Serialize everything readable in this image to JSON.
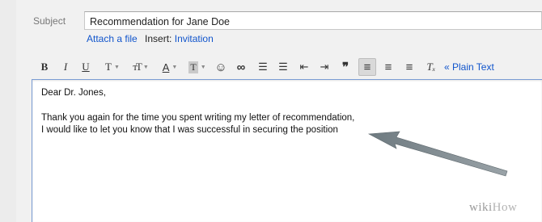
{
  "compose": {
    "subject_label": "Subject",
    "subject_value": "Recommendation for Jane Doe",
    "attach_label": "Attach a file",
    "insert_label": "Insert:",
    "invitation_label": "Invitation"
  },
  "toolbar": {
    "bold": "B",
    "italic": "I",
    "underline": "U",
    "font": "T",
    "size": "ᴛ",
    "text_color": "A",
    "highlight": "T",
    "emoji": "☺",
    "link": "∞",
    "numbered_list": "☰",
    "bulleted_list": "☰",
    "indent_less": "⇤",
    "indent_more": "⇥",
    "quote": "❞",
    "align_left": "≡",
    "align_center": "≡",
    "align_right": "≡",
    "remove_format": "Tₓ",
    "plain_text": "« Plain Text"
  },
  "message": {
    "greeting": "Dear Dr. Jones,",
    "line1": "Thank you again for the time you spent writing my letter of recommendation,",
    "line2": "I would like to let you know that I was successful in securing the position"
  },
  "watermark": {
    "wiki": "wiki",
    "how": "How"
  }
}
